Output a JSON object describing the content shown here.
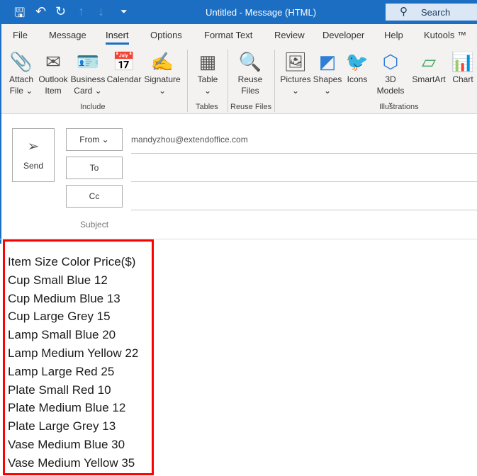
{
  "titlebar": {
    "title": "Untitled  -  Message (HTML)",
    "search": "Search"
  },
  "tabs": [
    "File",
    "Message",
    "Insert",
    "Options",
    "Format Text",
    "Review",
    "Developer",
    "Help",
    "Kutools ™"
  ],
  "ribbon": {
    "buttons": [
      {
        "l1": "Attach",
        "l2": "File ⌄",
        "icon": "paperclip"
      },
      {
        "l1": "Outlook",
        "l2": "Item",
        "icon": "envelope"
      },
      {
        "l1": "Business",
        "l2": "Card ⌄",
        "icon": "contact-card"
      },
      {
        "l1": "Calendar",
        "l2": "",
        "icon": "calendar"
      },
      {
        "l1": "Signature",
        "l2": "⌄",
        "icon": "signature"
      },
      {
        "l1": "Table",
        "l2": "⌄",
        "icon": "table"
      },
      {
        "l1": "Reuse",
        "l2": "Files",
        "icon": "reuse-files"
      },
      {
        "l1": "Pictures",
        "l2": "⌄",
        "icon": "picture"
      },
      {
        "l1": "Shapes",
        "l2": "⌄",
        "icon": "shapes"
      },
      {
        "l1": "Icons",
        "l2": "",
        "icon": "icons"
      },
      {
        "l1": "3D",
        "l2": "Models ⌄",
        "icon": "cube"
      },
      {
        "l1": "SmartArt",
        "l2": "",
        "icon": "smartart"
      },
      {
        "l1": "Chart",
        "l2": "",
        "icon": "chart"
      }
    ],
    "groups": [
      "Include",
      "Tables",
      "Reuse Files",
      "Illustrations"
    ]
  },
  "compose": {
    "send": "Send",
    "from": "From ⌄",
    "to": "To",
    "cc": "Cc",
    "subject": "Subject",
    "from_value": "mandyzhou@extendoffice.com"
  },
  "body": {
    "lines": [
      "Item Size Color Price($)",
      "Cup Small Blue 12",
      "Cup Medium Blue 13",
      "Cup Large Grey 15",
      "Lamp Small Blue 20",
      "Lamp Medium Yellow 22",
      "Lamp Large Red 25",
      "Plate Small Red 10",
      "Plate Medium Blue 12",
      "Plate Large Grey 13",
      "Vase Medium Blue 30",
      "Vase Medium Yellow 35"
    ]
  },
  "colors": {
    "accent": "#1b6ec2",
    "highlight": "#ff0000"
  }
}
